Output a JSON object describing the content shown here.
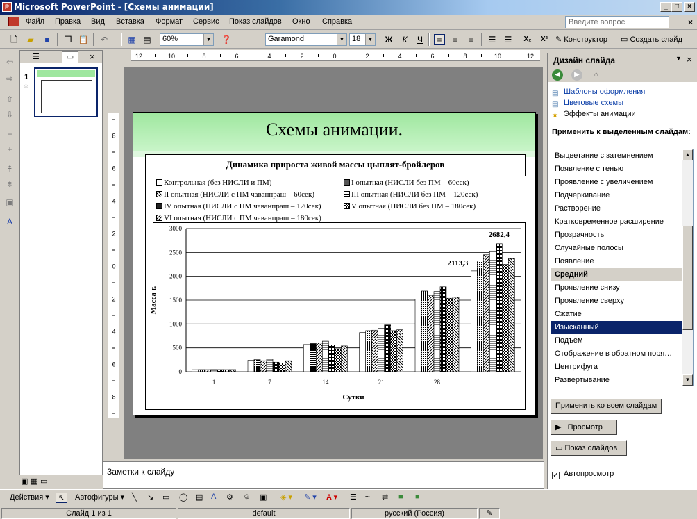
{
  "window": {
    "title": "Microsoft PowerPoint - [Схемы анимации]"
  },
  "menu": [
    "Файл",
    "Правка",
    "Вид",
    "Вставка",
    "Формат",
    "Сервис",
    "Показ слайдов",
    "Окно",
    "Справка"
  ],
  "ask_placeholder": "Введите вопрос",
  "toolbar": {
    "zoom": "60%",
    "font": "Garamond",
    "size": "18",
    "bold": "Ж",
    "italic": "К",
    "underline": "Ч",
    "constructor": "Конструктор",
    "new_slide": "Создать слайд"
  },
  "slides_pane": {
    "slide_number": "1"
  },
  "slide": {
    "title": "Схемы анимации.",
    "chart_title": "Динамика прироста живой массы цыплят-бройлеров"
  },
  "chart_data": {
    "type": "bar",
    "title": "Динамика прироста живой массы цыплят-бройлеров",
    "xlabel": "Сутки",
    "ylabel": "Масса г.",
    "ylim": [
      0,
      3000
    ],
    "yticks": [
      0,
      500,
      1000,
      1500,
      2000,
      2500,
      3000
    ],
    "categories": [
      "1",
      "7",
      "14",
      "21",
      "28",
      ""
    ],
    "series": [
      {
        "name": "Контрольная (без НИСЛИ и ПМ)",
        "values": [
          42,
          240,
          570,
          820,
          1520,
          2113.3
        ]
      },
      {
        "name": "I опытная (НИСЛИ без ПМ – 60сек)",
        "values": [
          44,
          255,
          590,
          860,
          1690,
          2320
        ]
      },
      {
        "name": "II опытная (НИСЛИ с ПМ чаванпраш – 60сек)",
        "values": [
          43,
          230,
          600,
          870,
          1600,
          2450
        ]
      },
      {
        "name": "III опытная (НИСЛИ без ПМ – 120сек)",
        "values": [
          45,
          260,
          640,
          910,
          1680,
          2530
        ]
      },
      {
        "name": "IV опытная (НИСЛИ с ПМ чаванпраш – 120сек)",
        "values": [
          44,
          200,
          560,
          980,
          1780,
          2682.4
        ]
      },
      {
        "name": "V опытная (НИСЛИ без ПМ – 180сек)",
        "values": [
          43,
          180,
          480,
          860,
          1540,
          2250
        ]
      },
      {
        "name": "VI опытная (НИСЛИ с ПМ чаванпраш – 180сек)",
        "values": [
          44,
          230,
          540,
          880,
          1560,
          2370
        ]
      }
    ],
    "annotations": [
      "2113,3",
      "2682,4"
    ]
  },
  "notes_placeholder": "Заметки к слайду",
  "task_pane": {
    "title": "Дизайн слайда",
    "links": [
      "Шаблоны оформления",
      "Цветовые схемы",
      "Эффекты анимации"
    ],
    "apply_label": "Применить к выделенным слайдам:",
    "effects": [
      "Выцветание с затемнением",
      "Появление с тенью",
      "Проявление с увеличением",
      "Подчеркивание",
      "Растворение",
      "Кратковременное расширение",
      "Прозрачность",
      "Случайные полосы",
      "Появление",
      "Средний",
      "Проявление снизу",
      "Проявление сверху",
      "Сжатие",
      "Изысканный",
      "Подъем",
      "Отображение в обратном поря…",
      "Центрифуга",
      "Развертывание"
    ],
    "apply_all": "Применить ко всем слайдам",
    "preview": "Просмотр",
    "slideshow": "Показ слайдов",
    "autopreview": "Автопросмотр"
  },
  "drawing": {
    "actions": "Действия",
    "autoshapes": "Автофигуры"
  },
  "status": {
    "slide": "Слайд 1 из 1",
    "design": "default",
    "lang": "русский (Россия)"
  }
}
